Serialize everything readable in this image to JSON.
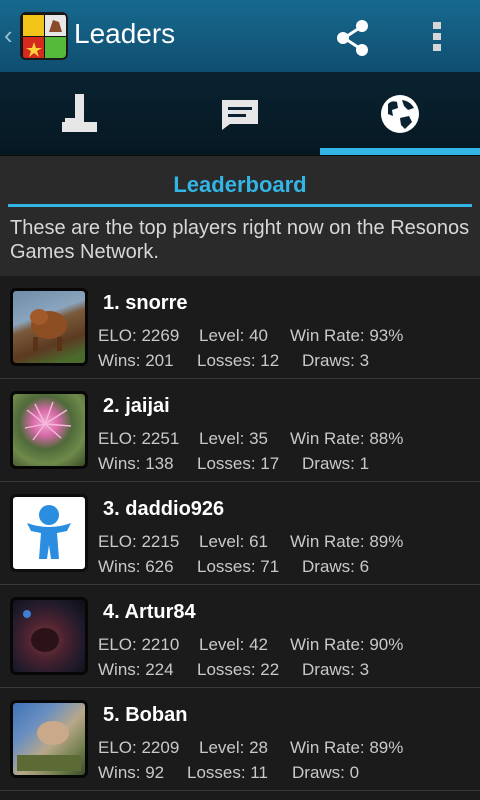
{
  "app": {
    "title": "Leaders"
  },
  "section": {
    "title": "Leaderboard",
    "intro": "These are the top players right now on the Resonos Games Network."
  },
  "players": [
    {
      "name": "1. snorre",
      "elo": "ELO: 2269",
      "level": "Level: 40",
      "winrate": "Win Rate: 93%",
      "wins": "Wins: 201",
      "losses": "Losses: 12",
      "draws": "Draws: 3"
    },
    {
      "name": "2. jaijai",
      "elo": "ELO: 2251",
      "level": "Level: 35",
      "winrate": "Win Rate: 88%",
      "wins": "Wins: 138",
      "losses": "Losses: 17",
      "draws": "Draws: 1"
    },
    {
      "name": "3. daddio926",
      "elo": "ELO: 2215",
      "level": "Level: 61",
      "winrate": "Win Rate: 89%",
      "wins": "Wins: 626",
      "losses": "Losses: 71",
      "draws": "Draws: 6"
    },
    {
      "name": "4. Artur84",
      "elo": "ELO: 2210",
      "level": "Level: 42",
      "winrate": "Win Rate: 90%",
      "wins": "Wins: 224",
      "losses": "Losses: 22",
      "draws": "Draws: 3"
    },
    {
      "name": "5. Boban",
      "elo": "ELO: 2209",
      "level": "Level: 28",
      "winrate": "Win Rate: 89%",
      "wins": "Wins: 92",
      "losses": "Losses: 11",
      "draws": "Draws: 0"
    }
  ],
  "colors": {
    "accent": "#33b5e5",
    "actionbar": "#136085"
  },
  "icons": {
    "share": "share-icon",
    "menu": "overflow-menu-icon",
    "tab1": "joystick-icon",
    "tab2": "chat-icon",
    "tab3": "globe-icon"
  }
}
